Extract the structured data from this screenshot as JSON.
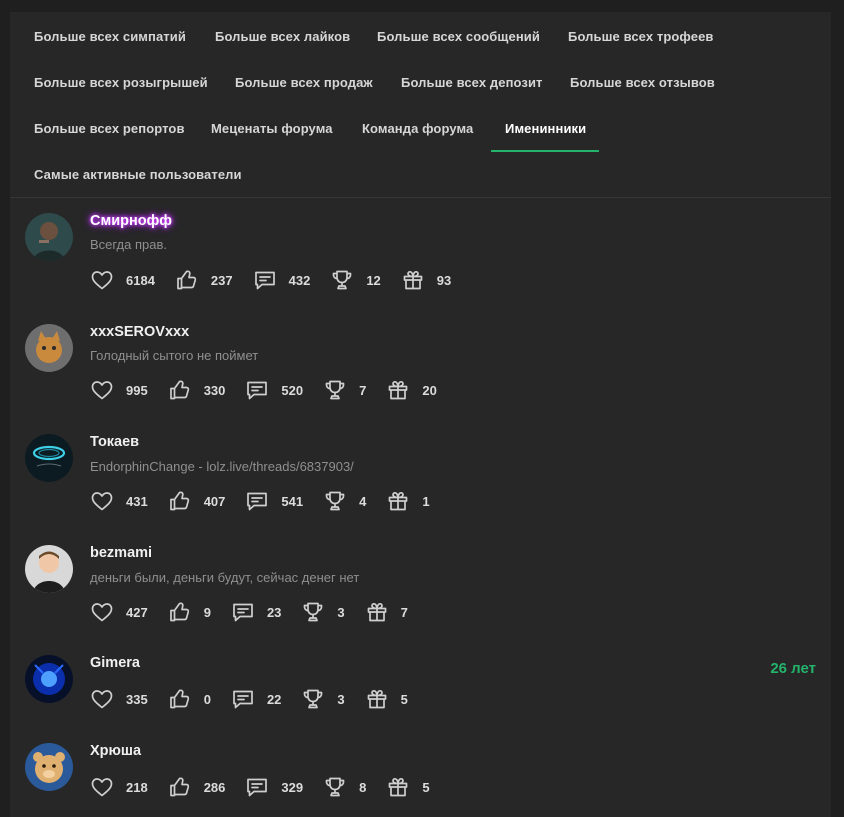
{
  "tabs": [
    {
      "label": "Больше всех симпатий"
    },
    {
      "label": "Больше всех лайков"
    },
    {
      "label": "Больше всех сообщений"
    },
    {
      "label": "Больше всех трофеев"
    },
    {
      "label": "Больше всех розыгрышей"
    },
    {
      "label": "Больше всех продаж"
    },
    {
      "label": "Больше всех депозит"
    },
    {
      "label": "Больше всех отзывов"
    },
    {
      "label": "Больше всех репортов"
    },
    {
      "label": "Меценаты форума"
    },
    {
      "label": "Команда форума"
    },
    {
      "label": "Именинники",
      "active": true
    },
    {
      "label": "Самые активные пользователи"
    }
  ],
  "users": [
    {
      "name": "Смирнофф",
      "status": "Всегда прав.",
      "stats": {
        "sympathies": "6184",
        "likes": "237",
        "messages": "432",
        "trophies": "12",
        "gifts": "93"
      }
    },
    {
      "name": "xxxSEROVxxx",
      "status": "Голодный сытого не поймет",
      "stats": {
        "sympathies": "995",
        "likes": "330",
        "messages": "520",
        "trophies": "7",
        "gifts": "20"
      }
    },
    {
      "name": "Токаев",
      "status": "EndorphinChange - lolz.live/threads/6837903/",
      "stats": {
        "sympathies": "431",
        "likes": "407",
        "messages": "541",
        "trophies": "4",
        "gifts": "1"
      }
    },
    {
      "name": "bezmami",
      "status": "деньги были, деньги будут, сейчас денег нет",
      "stats": {
        "sympathies": "427",
        "likes": "9",
        "messages": "23",
        "trophies": "3",
        "gifts": "7"
      }
    },
    {
      "name": "Gimera",
      "status": "",
      "age": "26 лет",
      "stats": {
        "sympathies": "335",
        "likes": "0",
        "messages": "22",
        "trophies": "3",
        "gifts": "5"
      }
    },
    {
      "name": "Хрюша",
      "status": "",
      "stats": {
        "sympathies": "218",
        "likes": "286",
        "messages": "329",
        "trophies": "8",
        "gifts": "5"
      }
    }
  ],
  "colors": {
    "accent": "#23b36b",
    "background": "#272727",
    "name_glow": "#c036ff"
  }
}
